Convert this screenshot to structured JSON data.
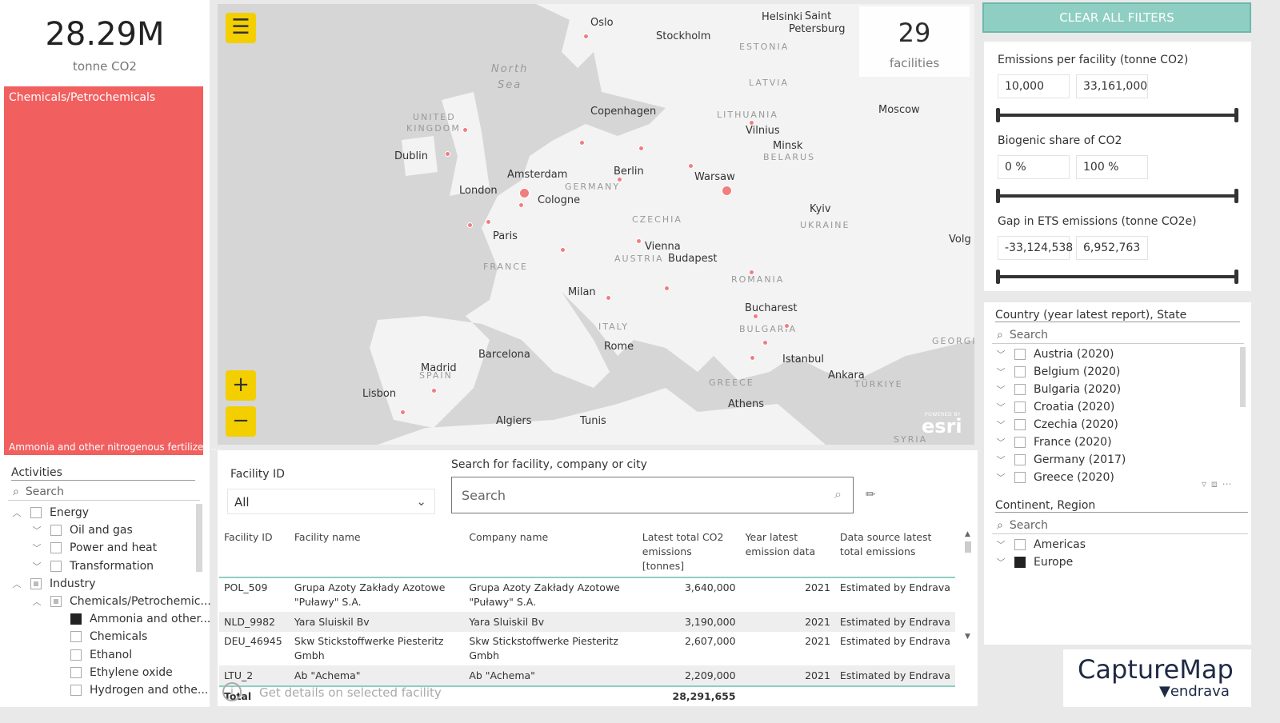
{
  "kpi": {
    "total_value": "28.29M",
    "total_unit": "tonne CO2",
    "facilities_count": "29",
    "facilities_label": "facilities"
  },
  "treemap": {
    "category": "Chemicals/Petrochemicals",
    "subcategory": "Ammonia and other nitrogenous fertilizer ...",
    "color": "#f15f5f"
  },
  "activities": {
    "title": "Activities",
    "search_placeholder": "Search",
    "items": [
      {
        "label": "Energy",
        "level": 0,
        "expand": "up",
        "state": "off"
      },
      {
        "label": "Oil and gas",
        "level": 1,
        "expand": "down",
        "state": "off"
      },
      {
        "label": "Power and heat",
        "level": 1,
        "expand": "down",
        "state": "off"
      },
      {
        "label": "Transformation",
        "level": 1,
        "expand": "down",
        "state": "off"
      },
      {
        "label": "Industry",
        "level": 0,
        "expand": "up",
        "state": "partial"
      },
      {
        "label": "Chemicals/Petrochemic...",
        "level": 1,
        "expand": "up",
        "state": "partial"
      },
      {
        "label": "Ammonia and other...",
        "level": 2,
        "expand": "",
        "state": "on"
      },
      {
        "label": "Chemicals",
        "level": 2,
        "expand": "",
        "state": "off"
      },
      {
        "label": "Ethanol",
        "level": 2,
        "expand": "",
        "state": "off"
      },
      {
        "label": "Ethylene oxide",
        "level": 2,
        "expand": "",
        "state": "off"
      },
      {
        "label": "Hydrogen and othe...",
        "level": 2,
        "expand": "",
        "state": "off"
      }
    ]
  },
  "map": {
    "labels": [
      "Oslo",
      "Stockholm",
      "Helsinki",
      "Saint",
      "Petersburg",
      "Copenhagen",
      "Vilnius",
      "Minsk",
      "Moscow",
      "Dublin",
      "Amsterdam",
      "Berlin",
      "Warsaw",
      "London",
      "Cologne",
      "Kyiv",
      "Paris",
      "Vienna",
      "Budapest",
      "Milan",
      "Bucharest",
      "Rome",
      "Barcelona",
      "Madrid",
      "Istanbul",
      "Ankara",
      "Lisbon",
      "Athens",
      "Algiers",
      "Tunis",
      "Volg"
    ],
    "regions": [
      "North",
      "Sea",
      "UNITED",
      "KINGDOM",
      "ESTONIA",
      "LATVIA",
      "LITHUANIA",
      "BELARUS",
      "GERMANY",
      "CZECHIA",
      "UKRAINE",
      "FRANCE",
      "AUSTRIA",
      "ROMANIA",
      "ITALY",
      "BULGARIA",
      "SPAIN",
      "GREECE",
      "TÜRKIYE",
      "GEORGI",
      "SYRIA"
    ],
    "attribution": "esri",
    "attribution_small": "POWERED BY"
  },
  "filters": {
    "facility_id_label": "Facility ID",
    "facility_id_value": "All",
    "search_label": "Search for facility, company or city",
    "search_placeholder": "Search"
  },
  "table": {
    "headers": [
      "Facility ID",
      "Facility name",
      "Company name",
      "Latest total CO2 emissions [tonnes]",
      "Year latest emission data",
      "Data source latest total emissions"
    ],
    "rows": [
      [
        "POL_509",
        "Grupa Azoty Zakłady Azotowe \"Puławy\" S.A.",
        "Grupa Azoty Zakłady Azotowe \"Puławy\" S.A.",
        "3,640,000",
        "2021",
        "Estimated by Endrava"
      ],
      [
        "NLD_9982",
        "Yara Sluiskil Bv",
        "Yara Sluiskil Bv",
        "3,190,000",
        "2021",
        "Estimated by Endrava"
      ],
      [
        "DEU_46945",
        "Skw Stickstoffwerke Piesteritz Gmbh",
        "Skw Stickstoffwerke Piesteritz Gmbh",
        "2,607,000",
        "2021",
        "Estimated by Endrava"
      ],
      [
        "LTU_2",
        "Ab \"Achema\"",
        "Ab \"Achema\"",
        "2,209,000",
        "2021",
        "Estimated by Endrava"
      ]
    ],
    "total_label": "Total",
    "total_value": "28,291,655"
  },
  "details_link": "Get details on selected facility",
  "right": {
    "clear_all": "CLEAR ALL FILTERS",
    "accent": "#8fcfc3",
    "sliders": [
      {
        "title": "Emissions per facility (tonne CO2)",
        "min": "10,000",
        "max": "33,161,000"
      },
      {
        "title": "Biogenic share of CO2",
        "min": "0 %",
        "max": "100 %"
      },
      {
        "title": "Gap in ETS emissions (tonne CO2e)",
        "min": "-33,124,538",
        "max": "6,952,763"
      }
    ],
    "country": {
      "title": "Country (year latest report), State",
      "search_placeholder": "Search",
      "items": [
        "Austria (2020)",
        "Belgium (2020)",
        "Bulgaria (2020)",
        "Croatia (2020)",
        "Czechia (2020)",
        "France (2020)",
        "Germany (2017)",
        "Greece (2020)"
      ]
    },
    "continent": {
      "title": "Continent, Region",
      "search_placeholder": "Search",
      "items": [
        {
          "label": "Americas",
          "state": "off"
        },
        {
          "label": "Europe",
          "state": "on"
        }
      ]
    }
  },
  "logo": {
    "name": "CaptureMap",
    "by": "endrava"
  }
}
